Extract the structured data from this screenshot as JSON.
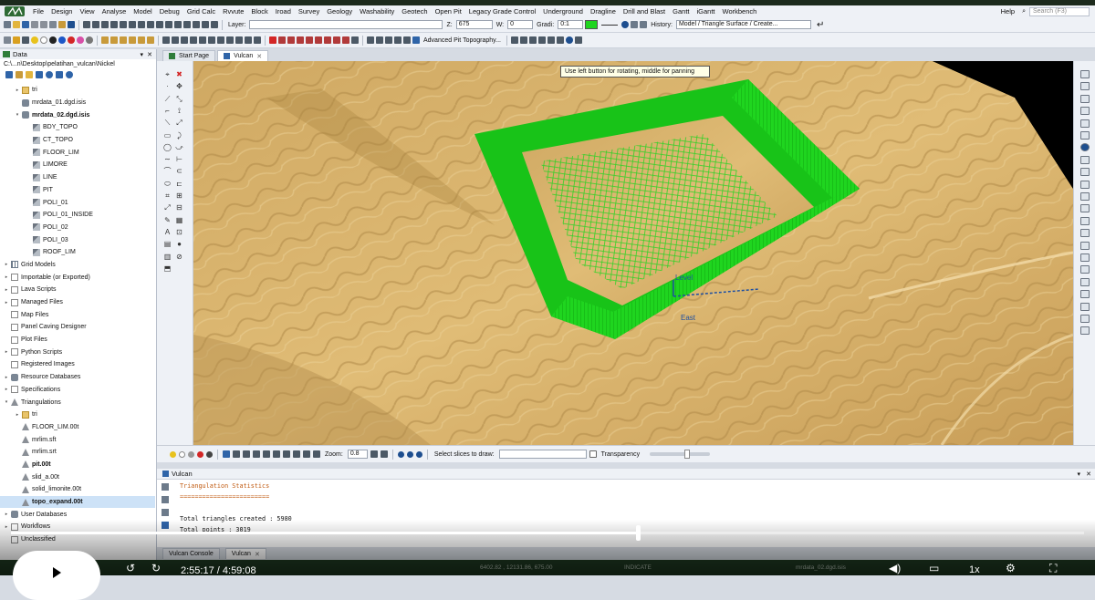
{
  "menu": [
    "File",
    "Design",
    "View",
    "Analyse",
    "Model",
    "Debug",
    "Grid Calc",
    "Rvvute",
    "Block",
    "Iroad",
    "Survey",
    "Geology",
    "Washability",
    "Geotech",
    "Open Pit",
    "Legacy Grade Control",
    "Underground",
    "Dragline",
    "Drill and Blast",
    "Gantt",
    "iGantt",
    "Workbench"
  ],
  "menu_right": {
    "help": "Help",
    "search_placeholder": "Search (F3)"
  },
  "toolbar1": {
    "layer_label": "Layer:",
    "z_label": "Z:",
    "z_value": "675",
    "w_label": "W:",
    "w_value": "0",
    "grad_label": "Gradi:",
    "grad_value": "0:1",
    "history_label": "History:",
    "history_value": "Model / Triangle Surface / Create..."
  },
  "toolbar2": {
    "advanced_label": "Advanced Pit Topography..."
  },
  "panel": {
    "title": "Data",
    "path": "C:\\...n\\Desktop\\pelatihan_vulcan\\Nickel"
  },
  "tree": [
    {
      "label": "tri",
      "indent": 1,
      "icon": "folder",
      "arrow": "▸"
    },
    {
      "label": "mrdata_01.dgd.isis",
      "indent": 1,
      "icon": "db",
      "arrow": ""
    },
    {
      "label": "mrdata_02.dgd.isis",
      "indent": 1,
      "icon": "db",
      "arrow": "▾",
      "bold": true
    },
    {
      "label": "BDY_TOPO",
      "indent": 2,
      "icon": "layer"
    },
    {
      "label": "CT_TOPO",
      "indent": 2,
      "icon": "layer"
    },
    {
      "label": "FLOOR_LIM",
      "indent": 2,
      "icon": "layer"
    },
    {
      "label": "LIMORE",
      "indent": 2,
      "icon": "layer"
    },
    {
      "label": "LINE",
      "indent": 2,
      "icon": "layer"
    },
    {
      "label": "PIT",
      "indent": 2,
      "icon": "layer"
    },
    {
      "label": "POLI_01",
      "indent": 2,
      "icon": "layer"
    },
    {
      "label": "POLI_01_INSIDE",
      "indent": 2,
      "icon": "layer"
    },
    {
      "label": "POLI_02",
      "indent": 2,
      "icon": "layer"
    },
    {
      "label": "POLI_03",
      "indent": 2,
      "icon": "layer"
    },
    {
      "label": "ROOF_LIM",
      "indent": 2,
      "icon": "layer"
    },
    {
      "label": "Grid Models",
      "indent": 0,
      "icon": "grid",
      "arrow": "▸"
    },
    {
      "label": "Importable (or Exported)",
      "indent": 0,
      "icon": "doc",
      "arrow": "▸"
    },
    {
      "label": "Lava Scripts",
      "indent": 0,
      "icon": "doc",
      "arrow": "▸"
    },
    {
      "label": "Managed Files",
      "indent": 0,
      "icon": "doc",
      "arrow": "▸"
    },
    {
      "label": "Map Files",
      "indent": 0,
      "icon": "doc",
      "arrow": ""
    },
    {
      "label": "Panel Caving Designer",
      "indent": 0,
      "icon": "doc",
      "arrow": ""
    },
    {
      "label": "Plot Files",
      "indent": 0,
      "icon": "doc",
      "arrow": ""
    },
    {
      "label": "Python Scripts",
      "indent": 0,
      "icon": "doc",
      "arrow": "▸"
    },
    {
      "label": "Registered Images",
      "indent": 0,
      "icon": "doc",
      "arrow": ""
    },
    {
      "label": "Resource Databases",
      "indent": 0,
      "icon": "db",
      "arrow": "▸"
    },
    {
      "label": "Specifications",
      "indent": 0,
      "icon": "doc",
      "arrow": "▸"
    },
    {
      "label": "Triangulations",
      "indent": 0,
      "icon": "tri",
      "arrow": "▾"
    },
    {
      "label": "tri",
      "indent": 1,
      "icon": "folder",
      "arrow": "▸"
    },
    {
      "label": "FLOOR_LIM.00t",
      "indent": 1,
      "icon": "tri"
    },
    {
      "label": "mrlim.sft",
      "indent": 1,
      "icon": "tri"
    },
    {
      "label": "mrlim.srt",
      "indent": 1,
      "icon": "tri"
    },
    {
      "label": "pit.00t",
      "indent": 1,
      "icon": "tri",
      "bold": true
    },
    {
      "label": "slid_a.00t",
      "indent": 1,
      "icon": "tri"
    },
    {
      "label": "solid_limonite.00t",
      "indent": 1,
      "icon": "tri"
    },
    {
      "label": "topo_expand.00t",
      "indent": 1,
      "icon": "tri",
      "bold": true,
      "selected": true
    },
    {
      "label": "User Databases",
      "indent": 0,
      "icon": "db",
      "arrow": "▸"
    },
    {
      "label": "Workflows",
      "indent": 0,
      "icon": "doc",
      "arrow": "▸"
    },
    {
      "label": "Unclassified",
      "indent": 0,
      "icon": "doc",
      "arrow": ""
    }
  ],
  "tabs": [
    {
      "label": "Start Page",
      "active": false
    },
    {
      "label": "Vulcan",
      "active": true
    }
  ],
  "tooltip": "Use left button for rotating, middle for panning",
  "axis_labels": {
    "level": "Level",
    "east": "East"
  },
  "viewbar": {
    "zoom_label": "Zoom:",
    "zoom_value": "0.8",
    "slices_label": "Select slices to draw:",
    "transparency_label": "Transparency"
  },
  "console": {
    "title": "Vulcan",
    "lines": [
      {
        "text": "Triangulation Statistics",
        "orange": true
      },
      {
        "text": "========================",
        "orange": true
      },
      {
        "text": "",
        "orange": false
      },
      {
        "text": "Total triangles created : 5980",
        "orange": false
      },
      {
        "text": "Total points : 3019",
        "orange": false
      }
    ]
  },
  "bottom_tabs": [
    "Vulcan Console",
    "Vulcan"
  ],
  "status": {
    "coords": "6402.82 , 12131.86, 675.00",
    "mode": "INDICATE",
    "file": "mrdata_02.dgd.isis"
  },
  "player": {
    "current": "2:55:17",
    "duration": "4:59:08",
    "speed": "1x",
    "progress": 0.585
  },
  "colors": {
    "terrain": "#d9b36a",
    "pit": "#1fd51f",
    "accent": "#0a5fb0"
  }
}
